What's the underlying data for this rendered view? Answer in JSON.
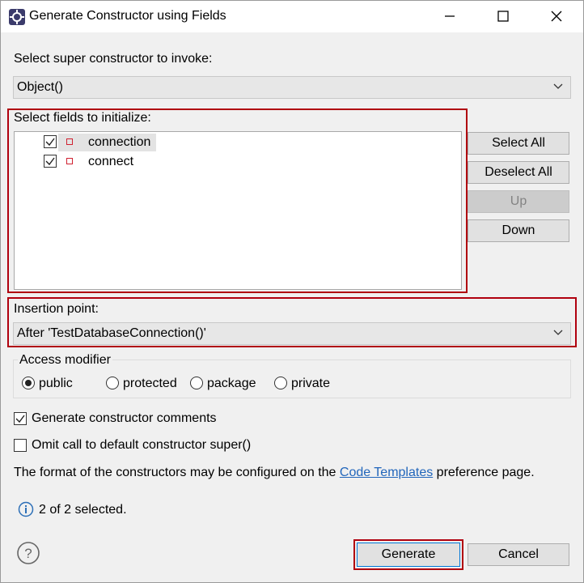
{
  "window": {
    "title": "Generate Constructor using Fields"
  },
  "super_constructor": {
    "label": "Select super constructor to invoke:",
    "value": "Object()"
  },
  "fields": {
    "label": "Select fields to initialize:",
    "items": [
      {
        "name": "connection",
        "checked": true
      },
      {
        "name": "connect",
        "checked": true
      }
    ]
  },
  "side_buttons": {
    "select_all": "Select All",
    "deselect_all": "Deselect All",
    "up": "Up",
    "down": "Down"
  },
  "insertion": {
    "label": "Insertion point:",
    "value": "After 'TestDatabaseConnection()'"
  },
  "access_modifier": {
    "label": "Access modifier",
    "options": [
      "public",
      "protected",
      "package",
      "private"
    ],
    "selected": "public"
  },
  "options": {
    "generate_comments": "Generate constructor comments",
    "omit_super": "Omit call to default constructor super()"
  },
  "info_text": {
    "prefix": "The format of the constructors may be configured on the",
    "link": "Code Templates",
    "suffix": "preference page."
  },
  "status": {
    "text": "2 of 2 selected."
  },
  "footer": {
    "generate": "Generate",
    "cancel": "Cancel"
  },
  "colors": {
    "highlight_red": "#b0000e",
    "link_blue": "#2266bb"
  }
}
